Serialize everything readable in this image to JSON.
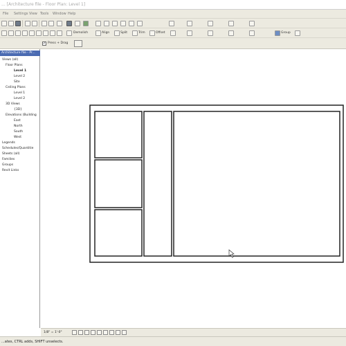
{
  "window": {
    "title": "... [Architecture file - Floor Plan: Level 1]"
  },
  "menu": [
    "File",
    "Settings",
    "View",
    "Tools",
    "Window",
    "Help"
  ],
  "toolbar2": {
    "demolish": "Demolish",
    "align": "Align",
    "split": "Split",
    "trim": "Trim",
    "offset": "Offset",
    "group": "Group",
    "view_3d": "3D"
  },
  "options_bar": {
    "checkbox_label": "Press + Drag",
    "checked": true
  },
  "project_browser": {
    "header": "Architecture file - Pr...",
    "items": [
      {
        "label": "Views (all)",
        "level": 0,
        "bold": false
      },
      {
        "label": "Floor Plans",
        "level": 1,
        "bold": false
      },
      {
        "label": "Level 1",
        "level": 2,
        "bold": true
      },
      {
        "label": "Level 2",
        "level": 2,
        "bold": false
      },
      {
        "label": "Site",
        "level": 2,
        "bold": false
      },
      {
        "label": "Ceiling Plans",
        "level": 1,
        "bold": false
      },
      {
        "label": "Level 1",
        "level": 2,
        "bold": false
      },
      {
        "label": "Level 2",
        "level": 2,
        "bold": false
      },
      {
        "label": "3D Views",
        "level": 1,
        "bold": false
      },
      {
        "label": "{3D}",
        "level": 2,
        "bold": false
      },
      {
        "label": "Elevations (Building",
        "level": 1,
        "bold": false
      },
      {
        "label": "East",
        "level": 2,
        "bold": false
      },
      {
        "label": "North",
        "level": 2,
        "bold": false
      },
      {
        "label": "South",
        "level": 2,
        "bold": false
      },
      {
        "label": "West",
        "level": 2,
        "bold": false
      },
      {
        "label": "Legends",
        "level": 0,
        "bold": false
      },
      {
        "label": "Schedules/Quantitie",
        "level": 0,
        "bold": false
      },
      {
        "label": "Sheets (all)",
        "level": 0,
        "bold": false
      },
      {
        "label": "Families",
        "level": 0,
        "bold": false
      },
      {
        "label": "Groups",
        "level": 0,
        "bold": false
      },
      {
        "label": "Revit Links",
        "level": 0,
        "bold": false
      }
    ]
  },
  "view_control": {
    "scale": "1/8\" = 1'-0\""
  },
  "status": {
    "text": "...ates, CTRL adds, SHIFT unselects."
  },
  "colors": {
    "chrome": "#eceae0",
    "browser_header": "#4b6bb2",
    "drawing_line": "#222222"
  }
}
